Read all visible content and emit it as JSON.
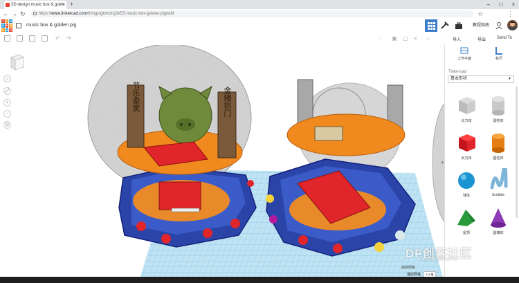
{
  "browser": {
    "tab_title": "3D design music box & golde",
    "url_host": "www.tinkercad.com",
    "url_path": "/things/gkmzkxjJeEZ-music-box-golden-pig/edit",
    "url_prefix": "https://"
  },
  "app": {
    "logo_letters": [
      "TIN",
      "KER",
      "CAD"
    ],
    "design_title": "music box & golden pig",
    "learn_label": "教程指南"
  },
  "panel": {
    "import_label": "导入",
    "export_label": "导出",
    "sendto_label": "Send To",
    "workplane_label": "工作平面",
    "ruler_label": "标尺",
    "library_caption": "Tinkercad",
    "library_selected": "基本形状",
    "shapes": [
      {
        "label": "长方体",
        "icon": "box-hole-icon"
      },
      {
        "label": "圆柱体",
        "icon": "cylinder-hole-icon"
      },
      {
        "label": "长方体",
        "icon": "box-icon"
      },
      {
        "label": "圆柱体",
        "icon": "cylinder-icon"
      },
      {
        "label": "球体",
        "icon": "sphere-icon"
      },
      {
        "label": "Scribble",
        "icon": "scribble-icon"
      },
      {
        "label": "屋顶",
        "icon": "roof-icon"
      },
      {
        "label": "圆锥体",
        "icon": "cone-icon"
      }
    ]
  },
  "viewport": {
    "edit_grid_label": "编辑网格",
    "snap_label": "捕捉网格",
    "snap_value": "1.0 毫",
    "sign_left_1": "节乐豪笑",
    "sign_left_2": "风调雨顺",
    "sign_right": "金猪拱门"
  },
  "watermark": {
    "main": "DF创客社区",
    "sub": "mc.DFRobot.com.cn"
  },
  "colors": {
    "accent": "#3d7cc9",
    "hex_base": "#2a44a8",
    "disc": "#f08a1f",
    "pig": "#6f8a3a",
    "board": "#e0262a"
  }
}
